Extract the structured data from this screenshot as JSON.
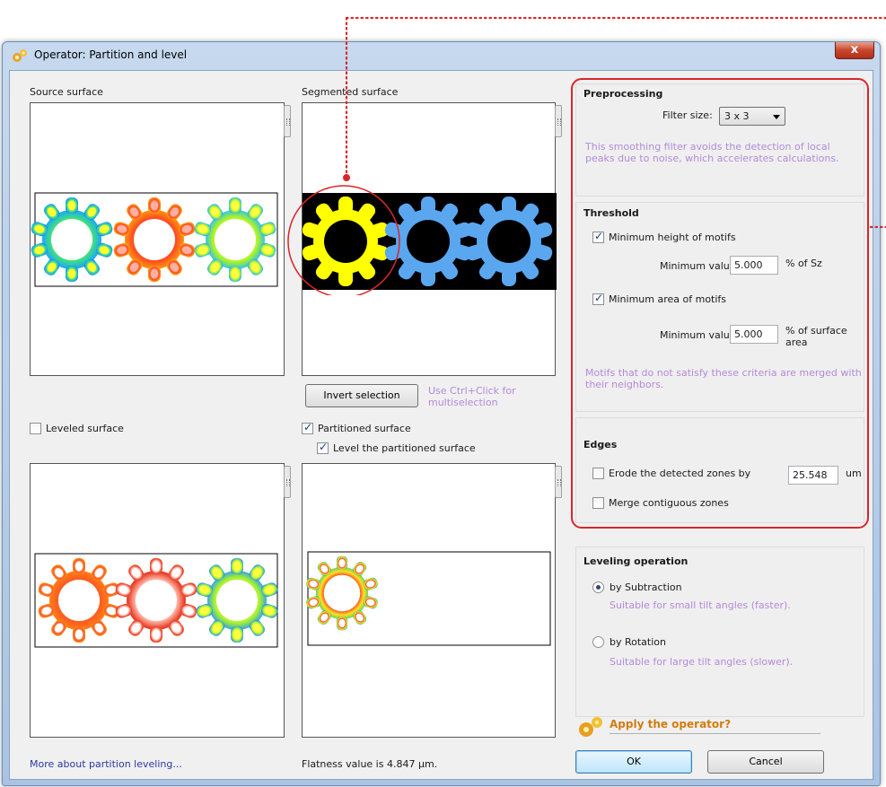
{
  "window": {
    "title": "Operator: Partition and level",
    "close_label": "x"
  },
  "source_surface": {
    "label": "Source surface"
  },
  "segmented_surface": {
    "label": "Segmented surface"
  },
  "invert": {
    "button_label": "Invert selection",
    "hint": "Use Ctrl+Click for multiselection"
  },
  "leveled_surface": {
    "label": "Leveled surface",
    "checked": false
  },
  "partitioned": {
    "label": "Partitioned surface",
    "checked": true,
    "level_label": "Level the partitioned surface",
    "level_checked": true
  },
  "footer": {
    "link": "More about partition leveling...",
    "flatness": "Flatness value is 4.847 µm."
  },
  "preprocessing": {
    "title": "Preprocessing",
    "filter_label": "Filter size:",
    "filter_value": "3 x 3",
    "hint": "This smoothing filter avoids the detection of local peaks due to noise, which accelerates calculations."
  },
  "threshold": {
    "title": "Threshold",
    "height_label": "Minimum height of motifs",
    "height_checked": true,
    "height_min_label": "Minimum value:",
    "height_min_value": "5.000",
    "height_unit": "% of Sz",
    "area_label": "Minimum area of motifs",
    "area_checked": true,
    "area_min_label": "Minimum value:",
    "area_min_value": "5.000",
    "area_unit_line1": "% of surface",
    "area_unit_line2": "area",
    "hint": "Motifs that do not satisfy these criteria are merged with their neighbors."
  },
  "edges": {
    "title": "Edges",
    "erode_label": "Erode the detected zones by",
    "erode_checked": false,
    "erode_value": "25.548",
    "erode_unit": "um",
    "merge_label": "Merge contiguous zones",
    "merge_checked": false
  },
  "leveling": {
    "title": "Leveling operation",
    "subtraction_label": "by Subtraction",
    "subtraction_hint": "Suitable for small tilt angles (faster).",
    "rotation_label": "by Rotation",
    "rotation_hint": "Suitable for large tilt angles (slower).",
    "selected": "subtraction"
  },
  "apply": {
    "label": "Apply the operator?"
  },
  "buttons": {
    "ok": "OK",
    "cancel": "Cancel"
  },
  "colors": {
    "annotation_red": "#d8262b",
    "hint_purple": "#b48ad8",
    "gear_yellow": "#ffff00",
    "gear_blue": "#5aa7f0"
  }
}
